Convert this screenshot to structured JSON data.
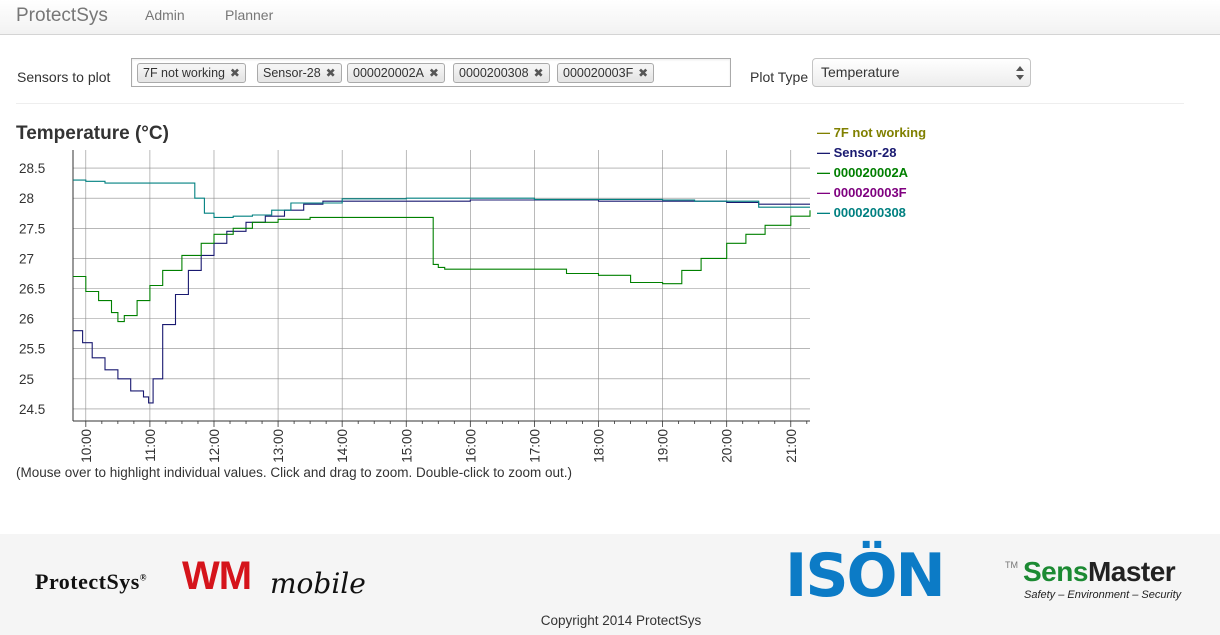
{
  "navbar": {
    "brand": "ProtectSys",
    "links": [
      "Admin",
      "Planner"
    ]
  },
  "controls": {
    "sensors_label": "Sensors to plot",
    "selected_sensors": [
      "7F not working",
      "Sensor-28",
      "000020002A",
      "0000200308",
      "000020003F"
    ],
    "remove_symbol": "✖",
    "plot_type_label": "Plot Type",
    "plot_type_value": "Temperature"
  },
  "hint": "(Mouse over to highlight individual values. Click and drag to zoom. Double-click to zoom out.)",
  "footer": {
    "copyright": "Copyright 2014 ProtectSys",
    "logo_protectsys": "ProtectSys",
    "logo_protectsys_tm": "®",
    "logo_wm": "WM",
    "logo_mobile": "mobile",
    "logo_ison": "ISÖN",
    "logo_ison_tm": "TM",
    "logo_sens": "Sens",
    "logo_master": "Master",
    "logo_tagline": "Safety – Environment – Security"
  },
  "icons": {
    "select_arrows": "updown-arrows-icon",
    "tag_remove": "remove-x-icon"
  },
  "chart_data": {
    "type": "line",
    "title": "Temperature (°C)",
    "xlabel": "",
    "ylabel": "",
    "xlim": [
      9.8,
      21.3
    ],
    "ylim": [
      24.3,
      28.8
    ],
    "x_ticks": [
      10,
      11,
      12,
      13,
      14,
      15,
      16,
      17,
      18,
      19,
      20,
      21
    ],
    "x_tick_labels": [
      "10:00",
      "11:00",
      "12:00",
      "13:00",
      "14:00",
      "15:00",
      "16:00",
      "17:00",
      "18:00",
      "19:00",
      "20:00",
      "21:00"
    ],
    "y_ticks": [
      24.5,
      25,
      25.5,
      26,
      26.5,
      27,
      27.5,
      28,
      28.5
    ],
    "y_tick_labels": [
      "24.5",
      "25",
      "25.5",
      "26",
      "26.5",
      "27",
      "27.5",
      "28",
      "28.5"
    ],
    "grid": true,
    "legend_position": "right",
    "series": [
      {
        "name": "7F not working",
        "color": "#808000",
        "x": [],
        "y": []
      },
      {
        "name": "Sensor-28",
        "color": "#191970",
        "x": [
          9.8,
          9.95,
          10.1,
          10.3,
          10.5,
          10.7,
          10.9,
          10.98,
          11.05,
          11.2,
          11.4,
          11.6,
          11.8,
          12.0,
          12.2,
          12.5,
          12.8,
          13.1,
          13.4,
          13.7,
          14.0,
          14.5,
          16.0,
          18.0,
          19.5,
          20.0,
          20.5,
          21.3
        ],
        "y": [
          25.8,
          25.6,
          25.35,
          25.15,
          25.0,
          24.8,
          24.7,
          24.6,
          25.0,
          25.9,
          26.4,
          26.8,
          27.05,
          27.25,
          27.45,
          27.6,
          27.7,
          27.8,
          27.9,
          27.95,
          27.95,
          27.95,
          27.97,
          27.95,
          27.95,
          27.93,
          27.9,
          27.9
        ]
      },
      {
        "name": "000020002A",
        "color": "#008000",
        "x": [
          9.8,
          10.0,
          10.2,
          10.4,
          10.5,
          10.6,
          10.8,
          11.0,
          11.2,
          11.5,
          11.8,
          12.0,
          12.3,
          12.6,
          13.0,
          13.5,
          14.0,
          15.0,
          15.38,
          15.42,
          15.5,
          15.6,
          16.0,
          16.5,
          17.1,
          17.5,
          18.0,
          18.5,
          19.0,
          19.3,
          19.6,
          20.0,
          20.3,
          20.6,
          21.0,
          21.3
        ],
        "y": [
          26.7,
          26.45,
          26.3,
          26.1,
          25.95,
          26.05,
          26.3,
          26.55,
          26.8,
          27.05,
          27.25,
          27.4,
          27.5,
          27.6,
          27.65,
          27.68,
          27.68,
          27.68,
          27.68,
          26.9,
          26.85,
          26.82,
          26.82,
          26.82,
          26.82,
          26.75,
          26.72,
          26.6,
          26.58,
          26.8,
          27.0,
          27.25,
          27.4,
          27.55,
          27.7,
          27.8
        ]
      },
      {
        "name": "000020003F",
        "color": "#800080",
        "x": [],
        "y": []
      },
      {
        "name": "0000200308",
        "color": "#008080",
        "x": [
          9.8,
          10.0,
          10.3,
          10.6,
          11.0,
          11.4,
          11.62,
          11.7,
          11.85,
          12.0,
          12.3,
          12.6,
          12.9,
          13.2,
          14.0,
          15.0,
          16.0,
          17.0,
          18.0,
          19.0,
          19.5,
          20.0,
          20.5,
          21.3
        ],
        "y": [
          28.3,
          28.28,
          28.25,
          28.25,
          28.25,
          28.25,
          28.25,
          28.0,
          27.75,
          27.68,
          27.7,
          27.72,
          27.8,
          27.92,
          27.99,
          28.0,
          28.0,
          27.98,
          27.98,
          27.97,
          27.95,
          27.95,
          27.85,
          27.85
        ]
      }
    ]
  }
}
